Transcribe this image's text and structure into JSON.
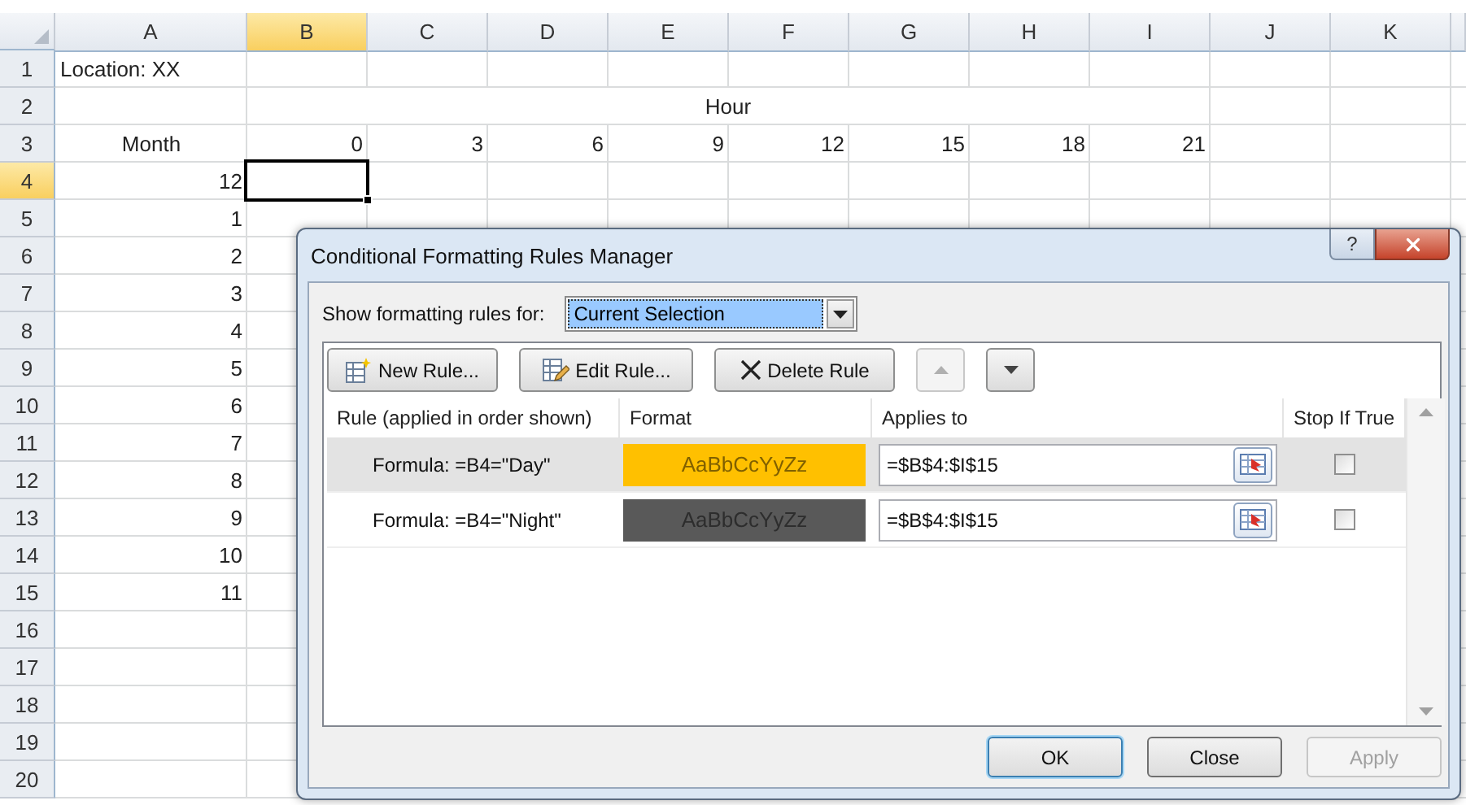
{
  "columns": [
    {
      "label": "A",
      "selected": false
    },
    {
      "label": "B",
      "selected": true
    },
    {
      "label": "C",
      "selected": false
    },
    {
      "label": "D",
      "selected": false
    },
    {
      "label": "E",
      "selected": false
    },
    {
      "label": "F",
      "selected": false
    },
    {
      "label": "G",
      "selected": false
    },
    {
      "label": "H",
      "selected": false
    },
    {
      "label": "I",
      "selected": false
    },
    {
      "label": "J",
      "selected": false
    },
    {
      "label": "K",
      "selected": false
    }
  ],
  "rows": [
    {
      "header": "1",
      "selected": false,
      "a": {
        "text": "Location: XX",
        "kind": "text"
      }
    },
    {
      "header": "2",
      "selected": false,
      "merged_title": "Hour"
    },
    {
      "header": "3",
      "selected": false,
      "a": {
        "text": "Month",
        "kind": "heading"
      },
      "values": [
        "0",
        "3",
        "6",
        "9",
        "12",
        "15",
        "18",
        "21"
      ]
    },
    {
      "header": "4",
      "selected": true,
      "a": {
        "text": "12",
        "kind": "number"
      }
    },
    {
      "header": "5",
      "selected": false,
      "a": {
        "text": "1",
        "kind": "number"
      }
    },
    {
      "header": "6",
      "selected": false,
      "a": {
        "text": "2",
        "kind": "number"
      }
    },
    {
      "header": "7",
      "selected": false,
      "a": {
        "text": "3",
        "kind": "number"
      }
    },
    {
      "header": "8",
      "selected": false,
      "a": {
        "text": "4",
        "kind": "number"
      }
    },
    {
      "header": "9",
      "selected": false,
      "a": {
        "text": "5",
        "kind": "number"
      }
    },
    {
      "header": "10",
      "selected": false,
      "a": {
        "text": "6",
        "kind": "number"
      }
    },
    {
      "header": "11",
      "selected": false,
      "a": {
        "text": "7",
        "kind": "number"
      }
    },
    {
      "header": "12",
      "selected": false,
      "a": {
        "text": "8",
        "kind": "number"
      }
    },
    {
      "header": "13",
      "selected": false,
      "a": {
        "text": "9",
        "kind": "number"
      }
    },
    {
      "header": "14",
      "selected": false,
      "a": {
        "text": "10",
        "kind": "number"
      }
    },
    {
      "header": "15",
      "selected": false,
      "a": {
        "text": "11",
        "kind": "number"
      }
    },
    {
      "header": "16",
      "selected": false
    },
    {
      "header": "17",
      "selected": false
    },
    {
      "header": "18",
      "selected": false
    },
    {
      "header": "19",
      "selected": false
    },
    {
      "header": "20",
      "selected": false
    }
  ],
  "dialog": {
    "title": "Conditional Formatting Rules Manager",
    "help": "?",
    "filter_label": "Show formatting rules for:",
    "filter_value": "Current Selection",
    "toolbar": [
      {
        "kind": "new",
        "label": "New Rule...",
        "disabled": false
      },
      {
        "kind": "edit",
        "label": "Edit Rule...",
        "disabled": false
      },
      {
        "kind": "delete",
        "label": "Delete Rule",
        "disabled": false
      },
      {
        "kind": "up",
        "disabled": true
      },
      {
        "kind": "down",
        "disabled": false
      }
    ],
    "table_columns": [
      "Rule (applied in order shown)",
      "Format",
      "Applies to",
      "Stop If True"
    ],
    "rules": [
      {
        "rule": "Formula: =B4=\"Day\"",
        "preview": "AaBbCcYyZz",
        "color": "#ffc000",
        "applies_to": "=$B$4:$I$15",
        "stop_if_true": false,
        "selected": true
      },
      {
        "rule": "Formula: =B4=\"Night\"",
        "preview": "AaBbCcYyZz",
        "color": "#595959",
        "applies_to": "=$B$4:$I$15",
        "stop_if_true": false,
        "selected": false
      }
    ],
    "buttons": [
      {
        "label": "OK",
        "default": true,
        "disabled": false
      },
      {
        "label": "Close",
        "default": false,
        "disabled": false
      },
      {
        "label": "Apply",
        "default": false,
        "disabled": true
      }
    ]
  }
}
